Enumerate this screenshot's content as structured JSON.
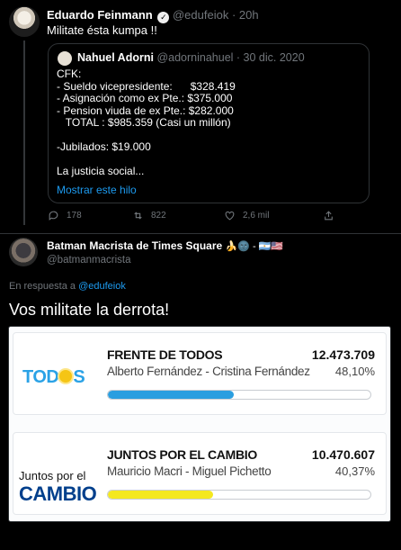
{
  "tweet": {
    "author_name": "Eduardo Feinmann",
    "author_handle": "@edufeiok",
    "time": "· 20h",
    "text": "Militate ésta kumpa !!",
    "quote": {
      "author_name": "Nahuel Adorni",
      "author_handle": "@adorninahuel",
      "date": "· 30 dic. 2020",
      "lines": [
        "CFK:",
        "- Sueldo vicepresidente:      $328.419",
        "- Asignación como ex Pte.: $375.000",
        "- Pension viuda de ex Pte.: $282.000",
        "   TOTAL : $985.359 (Casi un millón)",
        "",
        "-Jubilados: $19.000",
        "",
        "La justicia social..."
      ],
      "show_thread": "Mostrar este hilo"
    },
    "actions": {
      "replies": "178",
      "retweets": "822",
      "likes": "2,6 mil"
    }
  },
  "reply": {
    "author_name": "Batman Macrista de Times Square",
    "name_emoji": "🍌🌚 - 🇦🇷🇺🇸",
    "author_handle": "@batmanmacrista",
    "reply_prefix": "En respuesta a",
    "reply_to": "@edufeiok",
    "text": "Vos militate la derrota!"
  },
  "results": [
    {
      "logo_text": "TODOS",
      "party": "FRENTE DE TODOS",
      "candidates": "Alberto Fernández - Cristina Fernández",
      "votes": "12.473.709",
      "percent": "48,10%",
      "bar_fill": 0.48,
      "bar_color": "#2a9ee0"
    },
    {
      "logo_top": "Juntos por el",
      "logo_bottom": "CAMBIO",
      "party": "JUNTOS POR EL CAMBIO",
      "candidates": "Mauricio Macri - Miguel Pichetto",
      "votes": "10.470.607",
      "percent": "40,37%",
      "bar_fill": 0.4,
      "bar_color": "#f4e81f"
    }
  ],
  "icons": [
    "verified-icon",
    "reply-icon",
    "retweet-icon",
    "like-icon",
    "share-icon"
  ]
}
